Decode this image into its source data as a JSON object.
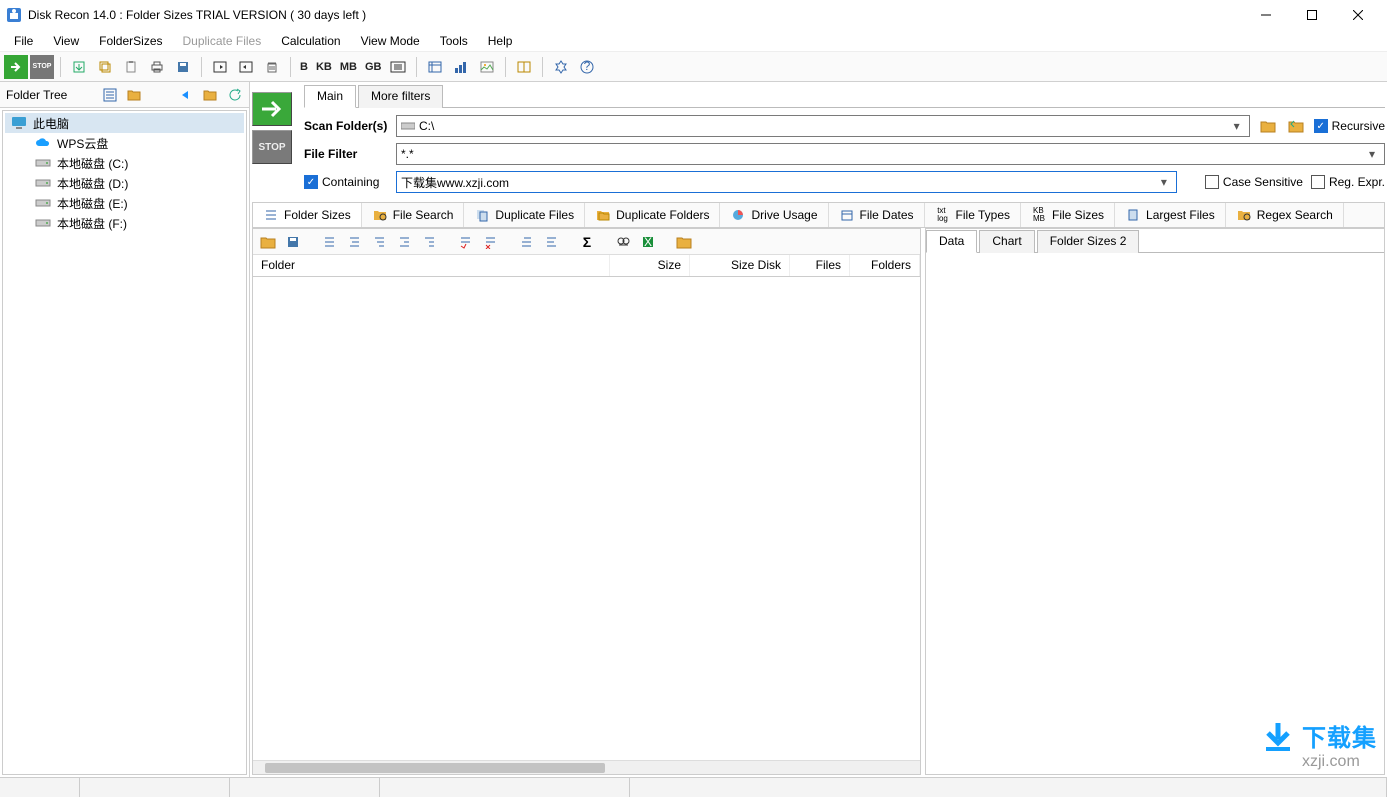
{
  "titlebar": {
    "title": "Disk Recon 14.0 : Folder Sizes  TRIAL VERSION ( 30 days left )"
  },
  "menu": {
    "file": "File",
    "view": "View",
    "foldersizes": "FolderSizes",
    "dupfiles": "Duplicate Files",
    "calc": "Calculation",
    "viewmode": "View Mode",
    "tools": "Tools",
    "help": "Help"
  },
  "toolbar_units": {
    "b": "B",
    "kb": "KB",
    "mb": "MB",
    "gb": "GB"
  },
  "left": {
    "header": "Folder Tree",
    "items": [
      {
        "label": "此电脑",
        "indent": 0,
        "selected": true,
        "icon": "monitor"
      },
      {
        "label": "WPS云盘",
        "indent": 1,
        "icon": "cloud"
      },
      {
        "label": "本地磁盘 (C:)",
        "indent": 1,
        "icon": "drive"
      },
      {
        "label": "本地磁盘 (D:)",
        "indent": 1,
        "icon": "drive"
      },
      {
        "label": "本地磁盘 (E:)",
        "indent": 1,
        "icon": "drive"
      },
      {
        "label": "本地磁盘 (F:)",
        "indent": 1,
        "icon": "drive"
      }
    ]
  },
  "tabs": {
    "main": "Main",
    "more": "More filters"
  },
  "form": {
    "scan_folders_label": "Scan Folder(s)",
    "scan_path": "C:\\",
    "file_filter_label": "File Filter",
    "file_filter_value": "*.*",
    "containing_label": "Containing",
    "containing_value": "下载集www.xzji.com",
    "recursive_label": "Recursive",
    "case_label": "Case Sensitive",
    "reg_label": "Reg. Expr."
  },
  "modtabs": {
    "foldersizes": "Folder Sizes",
    "filesearch": "File Search",
    "dupfiles": "Duplicate Files",
    "dupfolders": "Duplicate Folders",
    "driveusage": "Drive Usage",
    "filedates": "File Dates",
    "filetypes": "File Types",
    "filesizes": "File Sizes",
    "largest": "Largest Files",
    "regex": "Regex Search"
  },
  "cols": {
    "folder": "Folder",
    "size": "Size",
    "sizedisk": "Size Disk",
    "files": "Files",
    "folders": "Folders"
  },
  "rtabs": {
    "data": "Data",
    "chart": "Chart",
    "fs2": "Folder Sizes 2"
  },
  "watermark": {
    "brand": "下载集",
    "url": "xzji.com"
  }
}
